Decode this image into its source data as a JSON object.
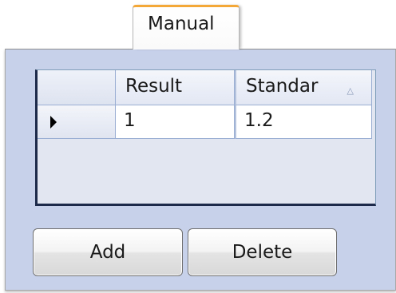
{
  "tab": {
    "label": "Manual"
  },
  "grid": {
    "columns": [
      "Result",
      "Standar"
    ],
    "sort_glyph": "△",
    "rows": [
      {
        "result": "1",
        "standar": "1.2"
      }
    ]
  },
  "buttons": {
    "add": "Add",
    "delete": "Delete"
  },
  "colors": {
    "tab_accent": "#f4a838",
    "panel_bg": "#c7d1ea",
    "grid_border": "#7f9db9"
  }
}
